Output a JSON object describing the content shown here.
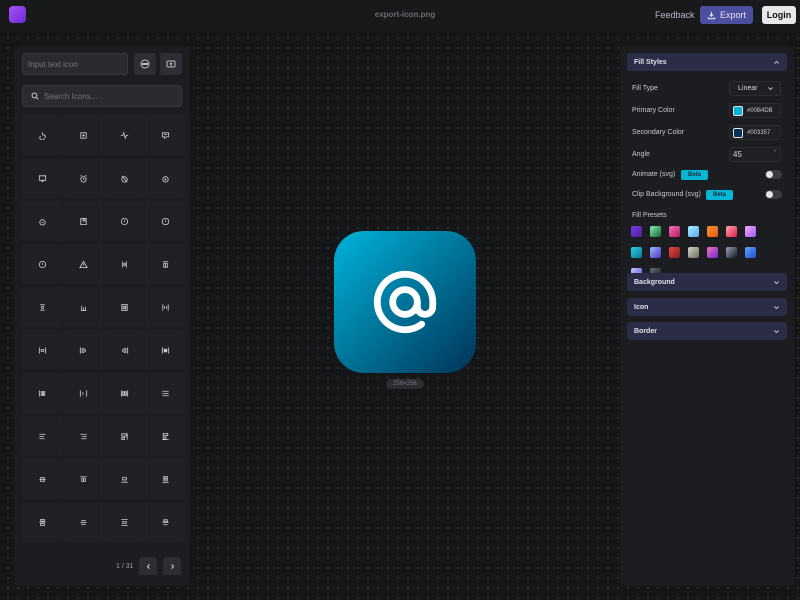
{
  "header": {
    "filename": "export-icon.png",
    "feedback_label": "Feedback",
    "export_label": "Export",
    "login_label": "Login"
  },
  "left_panel": {
    "text_icon_placeholder": "Input text icon",
    "search_placeholder": "Search Icons...",
    "icons": [
      "wheelchair-icon",
      "plus-square-icon",
      "activity-icon",
      "message-ad-icon",
      "device-desktop-icon",
      "alarm-icon",
      "alarm-off-icon",
      "alarm-plus-icon",
      "alarm-minus-icon",
      "album-icon",
      "alert-circle-icon",
      "alert-octagon-icon",
      "alert-circle-2-icon",
      "alert-triangle-icon",
      "align-center-icon",
      "align-box-icon",
      "align-justify-icon",
      "bar-chart-icon",
      "align-box-left-icon",
      "align-distributed-icon",
      "align-h-center-icon",
      "align-h-left-icon",
      "align-h-right-icon",
      "align-h-space-icon",
      "align-left-bars-icon",
      "align-h-between-icon",
      "align-right-bars-icon",
      "menu-icon",
      "align-left-icon",
      "align-right-icon",
      "align-box-top-icon",
      "align-box-bottom-icon",
      "align-v-center-icon",
      "align-v-top-icon",
      "align-v-bottom-icon",
      "align-v-stack-icon",
      "align-v-base-icon",
      "align-v-middle-icon",
      "align-v-spread-icon",
      "align-v-end-icon"
    ],
    "pager_text": "1 / 31"
  },
  "preview": {
    "icon": "at-sign-icon",
    "size_label": "256×256"
  },
  "right_panel": {
    "fill_styles_title": "Fill Styles",
    "fill_type_label": "Fill Type",
    "fill_type_value": "Linear",
    "primary_color_label": "Primary Color",
    "primary_color": "#00B4DB",
    "secondary_color_label": "Secondary Color",
    "secondary_color": "#003357",
    "angle_label": "Angle",
    "angle_value": "45",
    "angle_unit": "°",
    "animate_label": "Animate (svg)",
    "clip_label": "Clip Background (svg)",
    "beta_label": "Beta",
    "presets_label": "Fill Presets",
    "presets": [
      [
        "#7c3aed",
        "#4c1d95"
      ],
      [
        "#86efac",
        "#166534"
      ],
      [
        "#f472b6",
        "#be185d"
      ],
      [
        "#a5f3fc",
        "#60a5fa"
      ],
      [
        "#fb923c",
        "#ea580c"
      ],
      [
        "#fda4af",
        "#e11d48"
      ],
      [
        "#f0abfc",
        "#a855f7"
      ],
      [
        "#22d3ee",
        "#0e7490"
      ],
      [
        "#a5b4fc",
        "#4338ca"
      ],
      [
        "#ef4444",
        "#7f1d1d"
      ],
      [
        "#d6d3c4",
        "#6b6b5e"
      ],
      [
        "#f472b6",
        "#6d28d9"
      ],
      [
        "#9ca3af",
        "#111827"
      ],
      [
        "#60a5fa",
        "#1d4ed8"
      ],
      [
        "#c7d2fe",
        "#4f46e5"
      ],
      [
        "#6b7280",
        "#111111"
      ]
    ],
    "sections": [
      "Background",
      "Icon",
      "Border"
    ]
  }
}
